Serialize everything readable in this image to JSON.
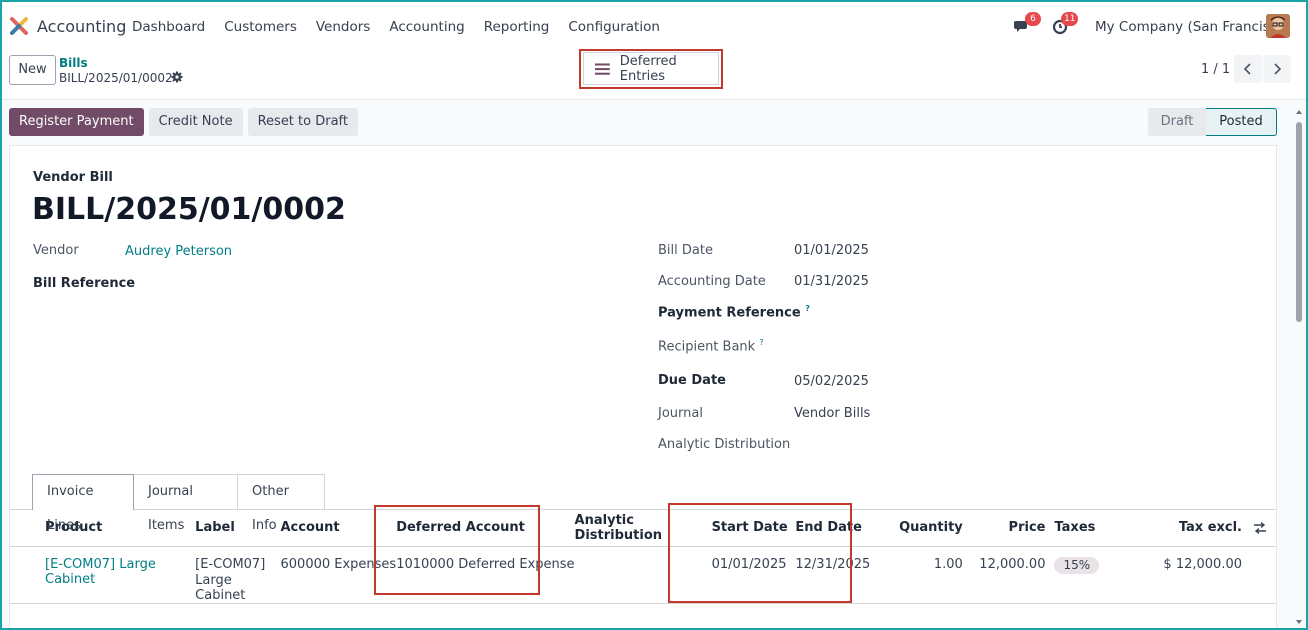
{
  "navbar": {
    "app_name": "Accounting",
    "menu": [
      "Dashboard",
      "Customers",
      "Vendors",
      "Accounting",
      "Reporting",
      "Configuration"
    ],
    "messages_count": "6",
    "activities_count": "11",
    "company": "My Company (San Francisco)"
  },
  "control_panel": {
    "new_label": "New",
    "breadcrumb_parent": "Bills",
    "breadcrumb_current": "BILL/2025/01/0002",
    "smart_button_label": "Deferred Entries",
    "pager": "1 / 1"
  },
  "actions": {
    "register_payment": "Register Payment",
    "credit_note": "Credit Note",
    "reset_to_draft": "Reset to Draft"
  },
  "status": {
    "draft": "Draft",
    "posted": "Posted"
  },
  "form": {
    "doc_type": "Vendor Bill",
    "doc_name": "BILL/2025/01/0002",
    "vendor_label": "Vendor",
    "vendor_value": "Audrey Peterson",
    "bill_reference_label": "Bill Reference",
    "bill_date_label": "Bill Date",
    "bill_date_value": "01/01/2025",
    "accounting_date_label": "Accounting Date",
    "accounting_date_value": "01/31/2025",
    "payment_reference_label": "Payment Reference",
    "recipient_bank_label": "Recipient Bank",
    "due_date_label": "Due Date",
    "due_date_value": "05/02/2025",
    "journal_label": "Journal",
    "journal_value": "Vendor Bills",
    "analytic_distribution_label": "Analytic Distribution",
    "help_mark": "?"
  },
  "tabs": [
    "Invoice Lines",
    "Journal Items",
    "Other Info"
  ],
  "table": {
    "headers": {
      "product": "Product",
      "label": "Label",
      "account": "Account",
      "deferred_account": "Deferred Account",
      "analytic": "Analytic Distribution",
      "start_date": "Start Date",
      "end_date": "End Date",
      "quantity": "Quantity",
      "price": "Price",
      "taxes": "Taxes",
      "tax_excl": "Tax excl."
    },
    "rows": [
      {
        "product": "[E-COM07] Large Cabinet",
        "label_line1": "[E-COM07]",
        "label_line2": "Large Cabinet",
        "account": "600000 Expenses",
        "deferred_account": "1010000 Deferred Expense",
        "analytic": "",
        "start_date": "01/01/2025",
        "end_date": "12/31/2025",
        "quantity": "1.00",
        "price": "12,000.00",
        "taxes": "15%",
        "tax_excl": "$ 12,000.00"
      }
    ]
  },
  "colors": {
    "brand": "#714b67",
    "link": "#017e84",
    "highlight": "#c0392b"
  }
}
